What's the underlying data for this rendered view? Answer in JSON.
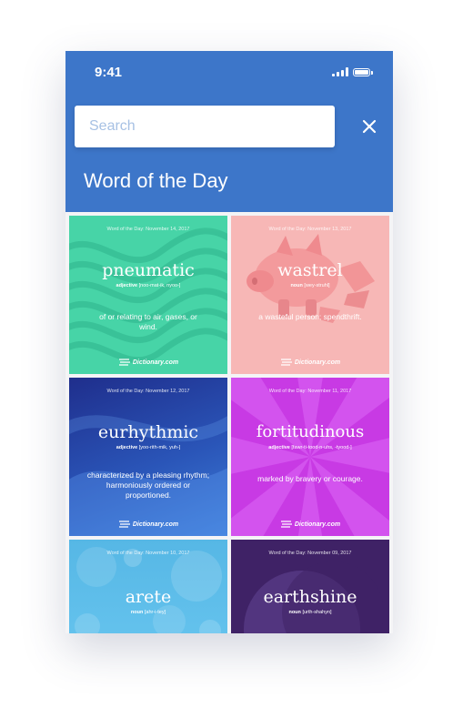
{
  "status_bar": {
    "time": "9:41"
  },
  "search": {
    "placeholder": "Search"
  },
  "header": {
    "title": "Word of the Day"
  },
  "cards": [
    {
      "date": "Word of the Day: November 14, 2017",
      "word": "pneumatic",
      "pos": "adjective",
      "pronunciation": "[noo-mat-ik, nyoo-]",
      "definition": "of or relating to air, gases, or wind.",
      "brand": "Dictionary.com",
      "bg_color": "#47d4a7"
    },
    {
      "date": "Word of the Day: November 13, 2017",
      "word": "wastrel",
      "pos": "noun",
      "pronunciation": "[wey-struhl]",
      "definition": "a wasteful person; spendthrift.",
      "brand": "Dictionary.com",
      "bg_color": "#f7b7b6"
    },
    {
      "date": "Word of the Day: November 12, 2017",
      "word": "eurhythmic",
      "pos": "adjective",
      "pronunciation": "[yoo-rith-mik, yuh-]",
      "definition": "characterized by a pleasing rhythm; harmoniously ordered or proportioned.",
      "brand": "Dictionary.com",
      "bg_color": "#2a4fb0"
    },
    {
      "date": "Word of the Day: November 11, 2017",
      "word": "fortitudinous",
      "pos": "adjective",
      "pronunciation": "[fawr-ti-tood-n-uhs, -tyood-]",
      "definition": "marked by bravery or courage.",
      "brand": "Dictionary.com",
      "bg_color": "#c83ae4"
    },
    {
      "date": "Word of the Day: November 10, 2017",
      "word": "arete",
      "pos": "noun",
      "pronunciation": "[ahr-i-tey]",
      "definition": "",
      "brand": "",
      "bg_color": "#5cbde9"
    },
    {
      "date": "Word of the Day: November 09, 2017",
      "word": "earthshine",
      "pos": "noun",
      "pronunciation": "[urth-shahyn]",
      "definition": "",
      "brand": "",
      "bg_color": "#3f2266"
    }
  ]
}
